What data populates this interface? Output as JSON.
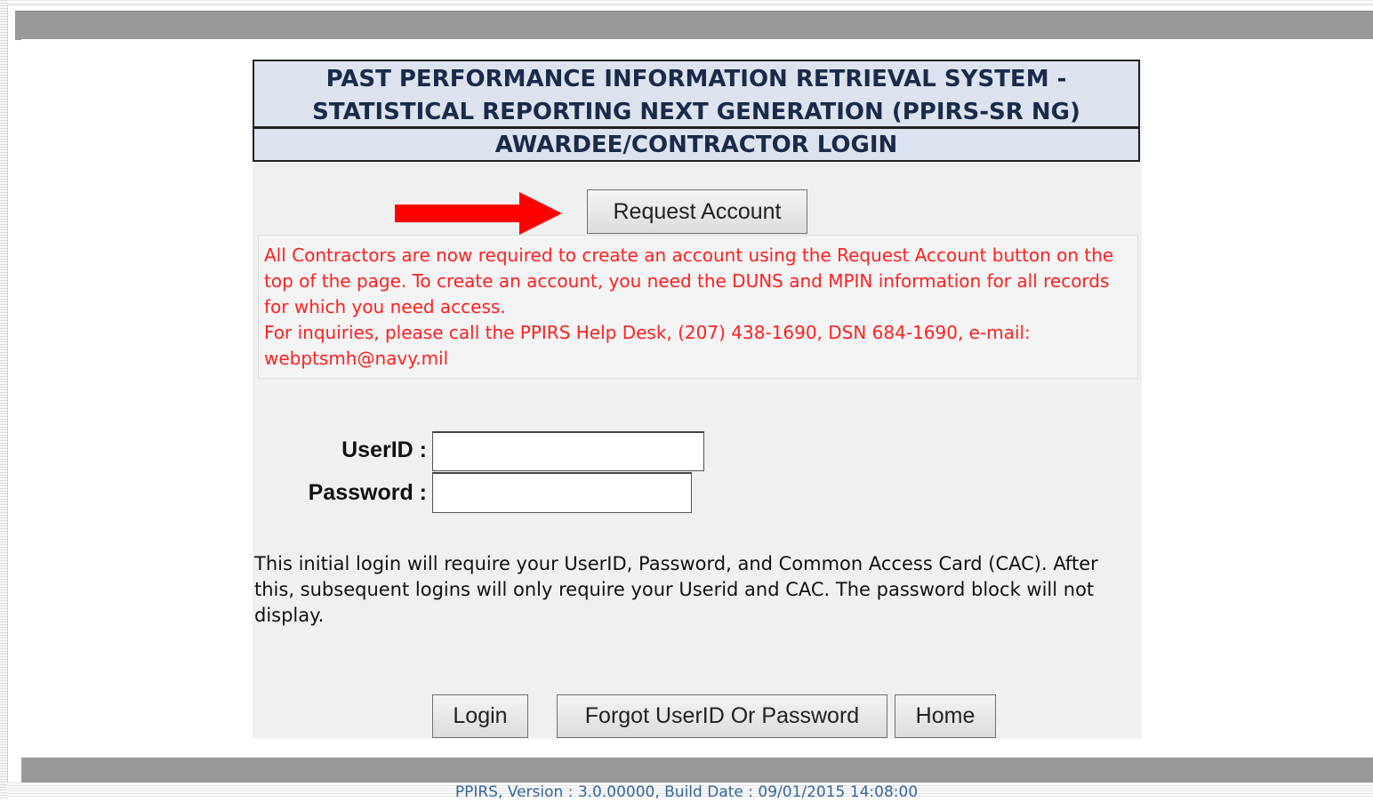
{
  "header": {
    "title_line1": "PAST PERFORMANCE INFORMATION RETRIEVAL SYSTEM -",
    "title_line2": "STATISTICAL REPORTING NEXT GENERATION (PPIRS-SR NG)",
    "subtitle": "AWARDEE/CONTRACTOR LOGIN"
  },
  "request_account": {
    "label": "Request Account"
  },
  "notice": {
    "color": "#ff2020",
    "text": "All Contractors are now required to create an account using the Request Account button on the top of the page. To create an account, you need the DUNS and MPIN information for all records for which you need access.",
    "inquiry": "For inquiries, please call the PPIRS Help Desk, (207) 438-1690, DSN 684-1690, e-mail: webptsmh@navy.mil"
  },
  "form": {
    "userid_label": "UserID :",
    "userid_value": "",
    "password_label": "Password :",
    "password_value": ""
  },
  "info": {
    "text": "This initial login will require your UserID, Password, and Common Access Card (CAC). After this, subsequent logins will only require your Userid and CAC. The password block will not display."
  },
  "buttons": {
    "login": "Login",
    "forgot": "Forgot UserID Or Password",
    "home": "Home"
  },
  "footer": {
    "version": "PPIRS, Version : 3.0.00000, Build Date : 09/01/2015 14:08:00"
  },
  "annotation": {
    "arrow_icon": "red-arrow-right-icon",
    "arrow_color": "#ff0000"
  }
}
